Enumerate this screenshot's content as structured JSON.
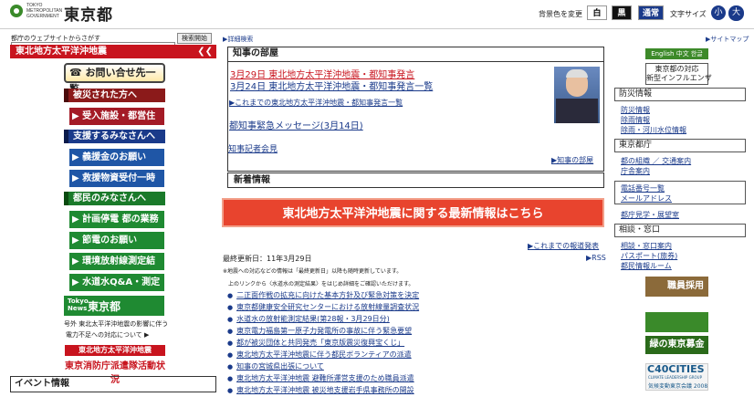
{
  "header": {
    "logo_en": "TOKYO\nMETROPOLITAN\nGOVERNMENT",
    "logo_ja": "東京都",
    "bg_label": "背景色を変更",
    "bg_white": "白",
    "bg_black": "黒",
    "bg_normal": "通常",
    "fontsize_label": "文字サイズ",
    "fontsize_small": "小",
    "fontsize_large": "大"
  },
  "search": {
    "label": "都庁のウェブサイトからさがす",
    "button": "検索開始",
    "advanced": "詳細検索",
    "sitemap": "サイトマップ"
  },
  "left": {
    "title": "東北地方太平洋沖地震",
    "chevrons": "❮❮",
    "contact": "お問い合せ先一覧",
    "sec_affected": "被災された方へ",
    "affected_items": [
      "受入施設・都営住宅等"
    ],
    "sec_support": "支援するみなさんへ",
    "support_items": [
      "義援金のお願い",
      "救援物資受付一時中止"
    ],
    "sec_citizens": "都民のみなさんへ",
    "citizen_items": [
      "計画停電 都の業務変更",
      "節電のお願い",
      "環境放射線測定結果",
      "水道水Q&A・測定結果"
    ],
    "news_small": "Tokyo\nNews",
    "news_big": "東京都",
    "news_cap1": "号外 東北太平洋沖地震の影響に伴う",
    "news_cap2": "電力不足への対応について ▶",
    "quake_red": "東北地方太平洋沖地震",
    "fire_text": "東京消防庁派遣隊活動状況",
    "event_title": "イベント情報"
  },
  "governor": {
    "title": "知事の部屋",
    "link1": "3月29日 東北地方太平洋沖地震・都知事発言",
    "link2": "3月24日 東北地方太平洋沖地震・都知事発言一覧",
    "link3": "▶これまでの東北地方太平洋沖地震・都知事発言一覧",
    "link4": "都知事緊急メッセージ(3月14日)",
    "link5": "知事記者会見",
    "more": "▶知事の部屋"
  },
  "news": {
    "title": "新着情報",
    "banner": "東北地方太平洋沖地震に関する最新情報はこちら",
    "past": "▶これまでの報道発表",
    "rss": "▶RSS",
    "updated": "最終更新日：11年3月29日",
    "note1": "※地震への対応などの情報は「最終更新日」以降も随時更新しています。",
    "note2": "上のリンクから〈水道水の測定結果〉をはじめ詳細をご確認いただけます。",
    "items": [
      "二正面作戦の拡充に向けた基本方針及び緊急対策を決定",
      "東京都健康安全研究センターにおける放射線量調査状況",
      "水道水の放射能測定結果(第28報・3月29日分)",
      "東京電力福島第一原子力発電所の事故に伴う緊急要望",
      "都が被災団体と共同発売「東京版震災復興宝くじ」",
      "東北地方太平洋沖地震に伴う都民ボランティアの派遣",
      "知事の宮城県出張について",
      "東北地方太平洋沖地震 避難所運営支援のため職員派遣",
      "東北地方太平洋沖地震 被災地支援岩手県事務所の開設"
    ]
  },
  "right": {
    "lang": "English 中文 한글",
    "flu": "東京都の対応\n新型インフルエンザ",
    "box_disaster": "防災情報",
    "disaster_links": [
      "防災情報",
      "除雨情報",
      "除雨・河川水位情報"
    ],
    "box_office": "東京都庁",
    "office_links": [
      "都の組織 ／ 交通案内",
      "庁舎案内"
    ],
    "box_contact": "電話番号一覧",
    "contact_links": [
      "メールアドレス"
    ],
    "tour": "都庁見学・展望室",
    "box_counsel": "相談・窓口",
    "counsel_links": [
      "相談・窓口案内",
      "パスポート(旅券)",
      "都民情報ルーム"
    ],
    "recruit": "職員採用",
    "green_fund": "緑の東京募金",
    "c40_title": "C40CITIES",
    "c40_sub": "CLIMATE LEADERSHIP GROUP",
    "c40_year": "気候変動東京会議 2008"
  }
}
